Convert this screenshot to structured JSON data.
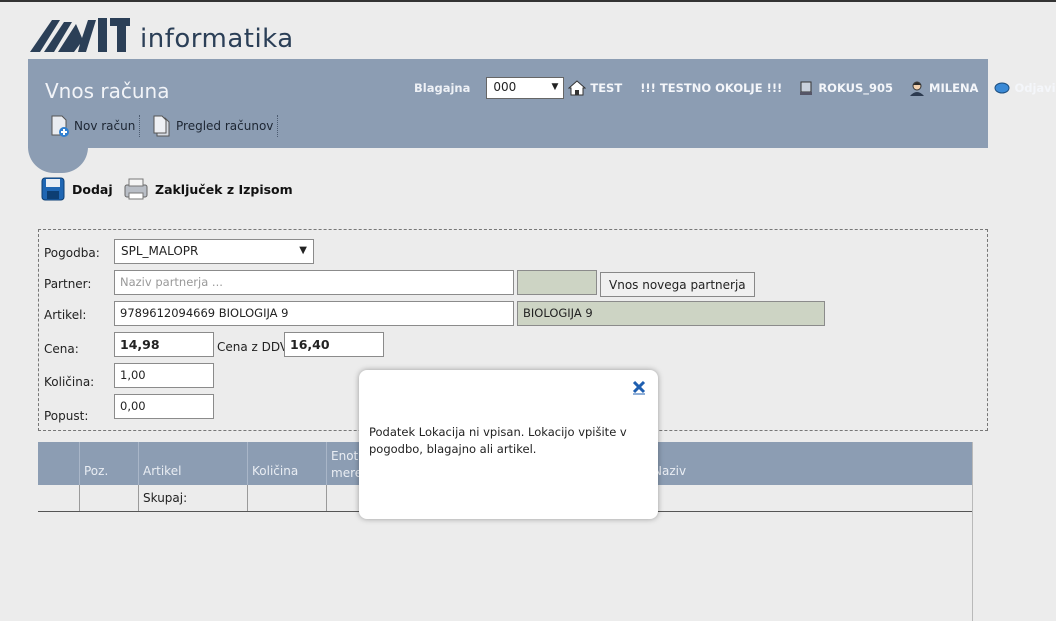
{
  "brand": {
    "logo_text": "informatika",
    "logo_mark": "MIT-logo-icon"
  },
  "header": {
    "title": "Vnos računa",
    "nav": [
      {
        "label": "Nov račun",
        "icon": "new-document-icon"
      },
      {
        "label": "Pregled računov",
        "icon": "documents-icon"
      }
    ],
    "kasa_label": "Blagajna",
    "kasa_value": "000",
    "home_label": "TEST",
    "env_label": "!!! TESTNO OKOLJE !!!",
    "device_label": "ROKUS_905",
    "user_label": "MILENA",
    "logout_label": "Odjavi"
  },
  "toolbar": {
    "add_label": "Dodaj",
    "close_label": "Zaključek z Izpisom"
  },
  "form": {
    "contract_label": "Pogodba:",
    "contract_value": "SPL_MALOPR",
    "partner_label": "Partner:",
    "partner_placeholder": "Naziv partnerja ...",
    "partner_code": "",
    "new_partner_btn": "Vnos novega partnerja",
    "article_label": "Artikel:",
    "article_value": "9789612094669 BIOLOGIJA 9",
    "article_name": "BIOLOGIJA 9",
    "price_label": "Cena:",
    "price_value": "14,98",
    "price_vat_label": "Cena z DDV:",
    "price_vat_value": "16,40",
    "qty_label": "Količina:",
    "qty_value": "1,00",
    "discount_label": "Popust:",
    "discount_value": "0,00"
  },
  "table": {
    "columns": [
      "",
      "Poz.",
      "Artikel",
      "Količina",
      "Enota mere",
      "",
      "",
      "Naziv"
    ],
    "sum_label": "Skupaj:"
  },
  "modal": {
    "message": "Podatek Lokacija ni vpisan. Lokacijo vpišite v pogodbo, blagajno ali artikel."
  },
  "colors": {
    "header": "#8c9db3",
    "accent": "#1f66b3"
  }
}
